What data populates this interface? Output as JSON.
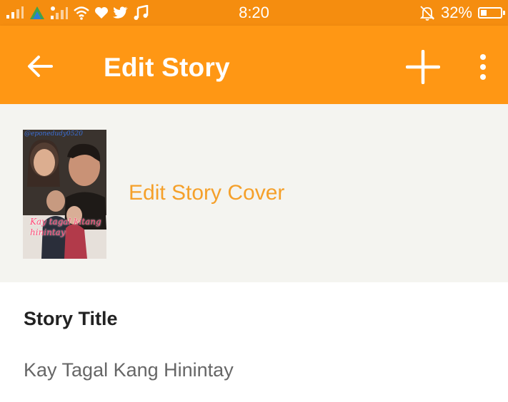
{
  "statusbar": {
    "time": "8:20",
    "battery_text": "32%",
    "battery_level": 0.32,
    "icons_left": [
      "signal-icon",
      "leaf-icon",
      "signal-2-icon",
      "wifi-icon",
      "heart-icon",
      "twitter-icon",
      "music-icon"
    ],
    "icons_right": [
      "bell-off-icon",
      "battery-icon"
    ]
  },
  "appbar": {
    "title": "Edit Story",
    "back_icon": "back-arrow-icon",
    "add_icon": "plus-icon",
    "more_icon": "more-vertical-icon",
    "color": "#ff9714"
  },
  "cover": {
    "author_text": "@eponedudy0520",
    "title_text": "Kay tagal kitang hinintay",
    "edit_label": "Edit Story Cover",
    "accent_color": "#f5a02a"
  },
  "story": {
    "title_label": "Story Title",
    "title_value": "Kay Tagal Kang Hinintay"
  }
}
